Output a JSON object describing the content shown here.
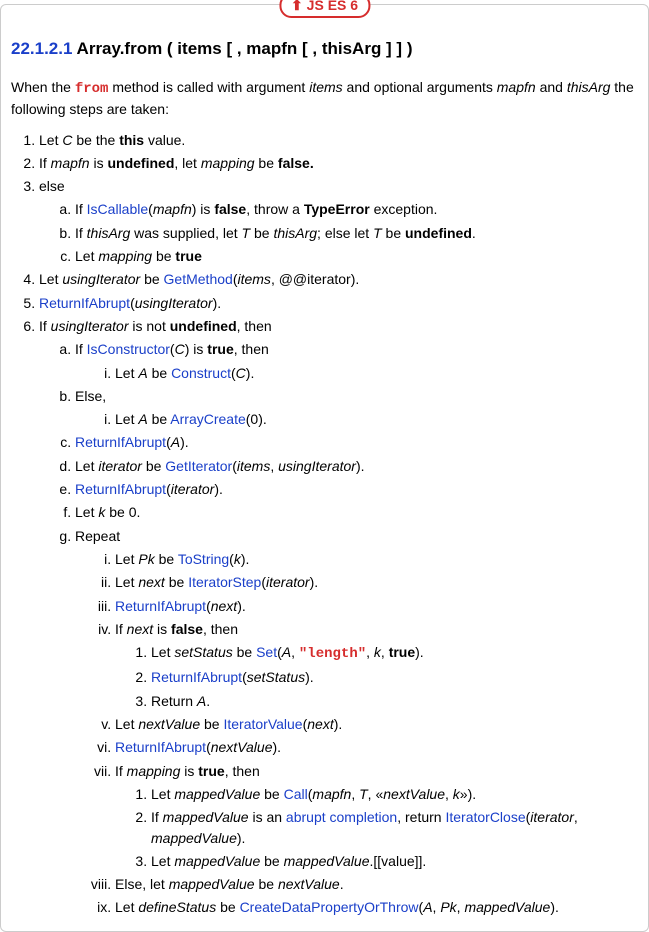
{
  "badge": "JS ES 6",
  "section_num": "22.1.2.1",
  "section_title": " Array.from ( items [ , mapfn [ , thisArg ] ] )",
  "intro_a": "When the ",
  "intro_kw": "from",
  "intro_b": " method is called with argument ",
  "intro_c": " and optional arguments ",
  "intro_d": " and ",
  "intro_e": " the following steps are taken:",
  "items_v": "items",
  "mapfn_v": "mapfn",
  "thisArg_v": "thisArg",
  "s1_a": "Let ",
  "s1_b": " be the ",
  "s1_c": " value.",
  "C_v": "C",
  "this_kw": "this",
  "s2_a": "If ",
  "s2_b": " is ",
  "undefined_kw": "undefined",
  "s2_c": ", let ",
  "mapping_v": "mapping",
  "s2_d": " be ",
  "false_kw": "false.",
  "s3": "else",
  "s3a_a": "If ",
  "IsCallable": "IsCallable",
  "s3a_b": "(",
  "s3a_c": ") is ",
  "false_kw2": "false",
  "s3a_d": ", throw a ",
  "TypeError_kw": "TypeError",
  "s3a_e": " exception.",
  "s3b_a": "If ",
  "s3b_b": " was supplied, let ",
  "T_v": "T",
  "s3b_c": " be ",
  "s3b_d": "; else let ",
  "s3b_e": " be ",
  "undefined_kw2": "undefined",
  "s3b_f": ".",
  "s3c_a": "Let ",
  "s3c_b": " be ",
  "true_kw": "true",
  "s4_a": "Let ",
  "usingIterator_v": "usingIterator",
  "s4_b": " be ",
  "GetMethod": "GetMethod",
  "s4_c": "(",
  "s4_d": ", @@iterator).",
  "s5_a": "",
  "ReturnIfAbrupt": "ReturnIfAbrupt",
  "s5_b": "(",
  "s5_c": ").",
  "s6_a": "If ",
  "s6_b": " is not ",
  "undefined_kw3": "undefined",
  "s6_c": ", then",
  "s6a_a": "If ",
  "IsConstructor": "IsConstructor",
  "s6a_b": "(",
  "s6a_c": ") is ",
  "true_kw2": "true",
  "s6a_d": ", then",
  "s6ai_a": "Let ",
  "A_v": "A",
  "s6ai_b": " be ",
  "Construct": "Construct",
  "s6ai_c": "(",
  "s6ai_d": ").",
  "s6b": "Else,",
  "s6bi_a": "Let ",
  "s6bi_b": " be ",
  "ArrayCreate": "ArrayCreate",
  "s6bi_c": "(0).",
  "s6c_b": "(",
  "s6c_c": ").",
  "s6d_a": "Let ",
  "iterator_v": "iterator",
  "s6d_b": " be ",
  "GetIterator": "GetIterator",
  "s6d_c": "(",
  "s6d_d": ", ",
  "s6d_e": ").",
  "s6e_b": "(",
  "s6e_c": ").",
  "s6f_a": "Let ",
  "k_v": "k",
  "s6f_b": " be 0.",
  "s6g": "Repeat",
  "s6gi_a": "Let ",
  "Pk_v": "Pk",
  "s6gi_b": " be ",
  "ToString": "ToString",
  "s6gi_c": "(",
  "s6gi_d": ").",
  "s6gii_a": "Let ",
  "next_v": "next",
  "s6gii_b": " be ",
  "IteratorStep": "IteratorStep",
  "s6gii_c": "(",
  "s6gii_d": ").",
  "s6giii_b": "(",
  "s6giii_c": ").",
  "s6giv_a": "If ",
  "s6giv_b": " is ",
  "false_kw3": "false",
  "s6giv_c": ", then",
  "s6giv1_a": "Let ",
  "setStatus_v": "setStatus",
  "s6giv1_b": " be ",
  "Set": "Set",
  "s6giv1_c": "(",
  "s6giv1_d": ", ",
  "length_str": "\"length\"",
  "s6giv1_e": ", ",
  "s6giv1_f": ", ",
  "true_kw3": "true",
  "s6giv1_g": ").",
  "s6giv2_b": "(",
  "s6giv2_c": ").",
  "s6giv3_a": "Return ",
  "s6giv3_b": ".",
  "s6gv_a": "Let ",
  "nextValue_v": "nextValue",
  "s6gv_b": " be ",
  "IteratorValue": "IteratorValue",
  "s6gv_c": "(",
  "s6gv_d": ").",
  "s6gvi_b": "(",
  "s6gvi_c": ").",
  "s6gvii_a": "If ",
  "s6gvii_b": " is ",
  "true_kw4": "true",
  "s6gvii_c": ", then",
  "s6gvii1_a": "Let ",
  "mappedValue_v": "mappedValue",
  "s6gvii1_b": " be ",
  "Call": "Call",
  "s6gvii1_c": "(",
  "s6gvii1_d": ", ",
  "s6gvii1_e": ", «",
  "s6gvii1_f": ", ",
  "s6gvii1_g": "»).",
  "s6gvii2_a": "If ",
  "s6gvii2_b": " is an ",
  "abrupt_completion": "abrupt completion",
  "s6gvii2_c": ", return ",
  "IteratorClose": "IteratorClose",
  "s6gvii2_d": "(",
  "s6gvii2_e": ", ",
  "s6gvii2_f": ").",
  "s6gvii3_a": "Let ",
  "s6gvii3_b": " be ",
  "s6gvii3_c": ".[[value]].",
  "s6gviii_a": "Else, let ",
  "s6gviii_b": " be ",
  "s6gviii_c": ".",
  "s6gix_a": "Let ",
  "defineStatus_v": "defineStatus",
  "s6gix_b": " be ",
  "CreateDataPropertyOrThrow": "CreateDataPropertyOrThrow",
  "s6gix_c": "(",
  "s6gix_d": ", ",
  "s6gix_e": ", ",
  "s6gix_f": ")."
}
